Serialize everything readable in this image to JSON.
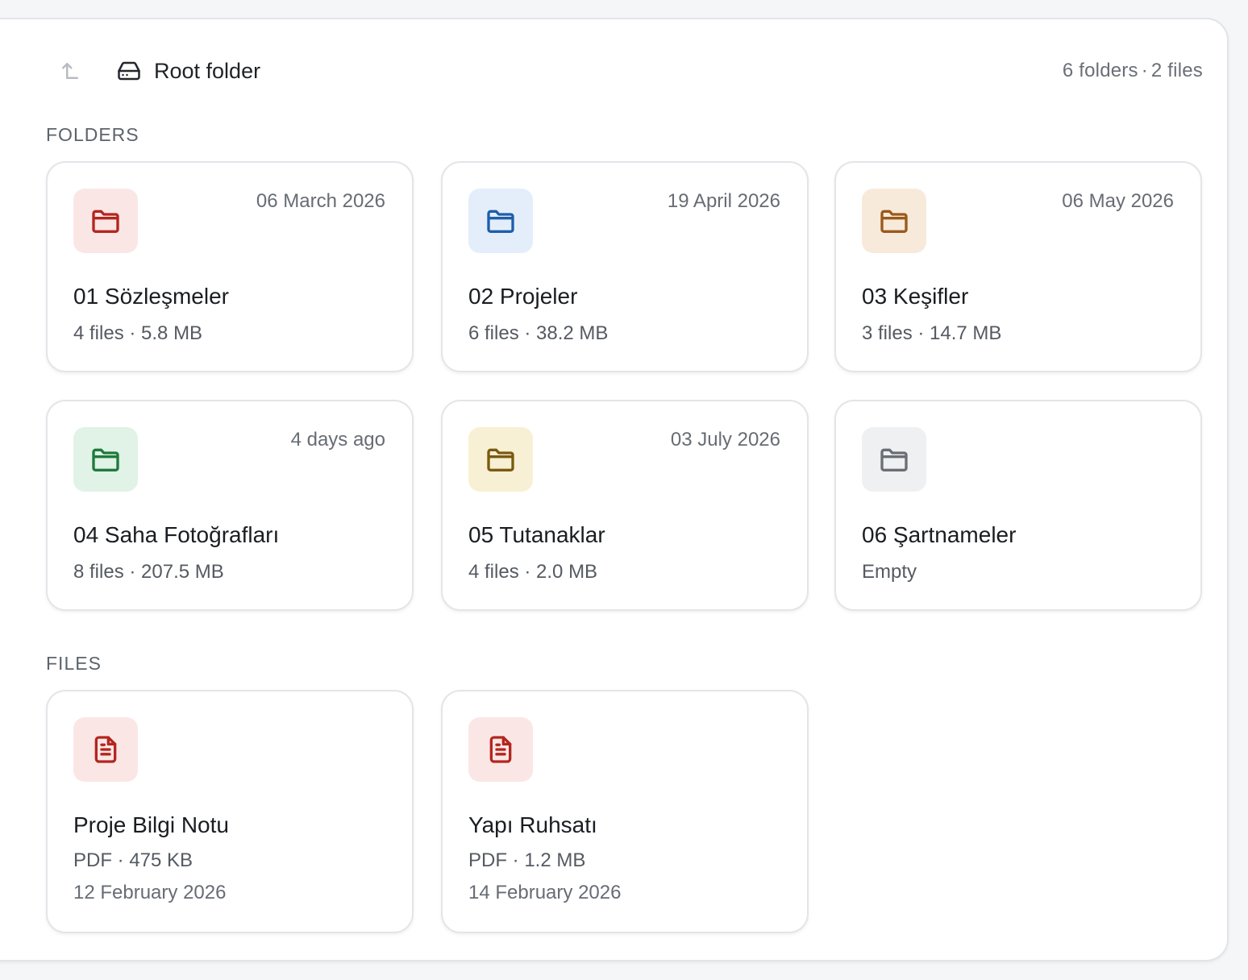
{
  "header": {
    "root_label": "Root folder",
    "summary_folders": "6 folders",
    "summary_files": "2 files",
    "up_icon": "arrow-up-left-icon",
    "drive_icon": "hard-drive-icon"
  },
  "sections": {
    "folders_label": "FOLDERS",
    "files_label": "FILES"
  },
  "folders": [
    {
      "name": "01 Sözleşmeler",
      "date": "06 March 2026",
      "files": "4 files",
      "size": "5.8 MB",
      "color": "#b3261e",
      "bg": "#fbe6e6"
    },
    {
      "name": "02 Projeler",
      "date": "19 April 2026",
      "files": "6 files",
      "size": "38.2 MB",
      "color": "#1d5fa8",
      "bg": "#e4eefa"
    },
    {
      "name": "03 Keşifler",
      "date": "06 May 2026",
      "files": "3 files",
      "size": "14.7 MB",
      "color": "#9a5a1a",
      "bg": "#f8eadb"
    },
    {
      "name": "04 Saha Fotoğrafları",
      "date": "4 days ago",
      "files": "8 files",
      "size": "207.5 MB",
      "color": "#1e7a3c",
      "bg": "#e1f2e6"
    },
    {
      "name": "05 Tutanaklar",
      "date": "03 July 2026",
      "files": "4 files",
      "size": "2.0 MB",
      "color": "#7a5a10",
      "bg": "#f8f0d4"
    },
    {
      "name": "06 Şartnameler",
      "date": "",
      "files": "Empty",
      "size": "",
      "color": "#6a6e75",
      "bg": "#eff0f2"
    }
  ],
  "files": [
    {
      "name": "Proje Bilgi Notu",
      "type": "PDF",
      "size": "475 KB",
      "date": "12 February 2026",
      "color": "#b3261e",
      "bg": "#fbe6e6"
    },
    {
      "name": "Yapı Ruhsatı",
      "type": "PDF",
      "size": "1.2 MB",
      "date": "14 February 2026",
      "color": "#b3261e",
      "bg": "#fbe6e6"
    }
  ]
}
